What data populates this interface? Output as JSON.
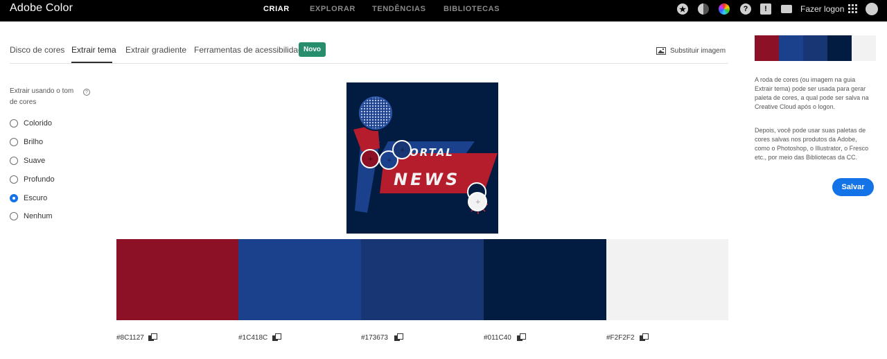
{
  "header": {
    "brand": "Adobe Color",
    "nav": [
      {
        "label": "CRIAR",
        "active": true
      },
      {
        "label": "EXPLORAR",
        "active": false
      },
      {
        "label": "TENDÊNCIAS",
        "active": false
      },
      {
        "label": "BIBLIOTECAS",
        "active": false
      }
    ],
    "icons": [
      "star-icon",
      "contrast-icon",
      "color-wheel-icon",
      "help-icon",
      "alert-icon",
      "chat-icon",
      "apps-grid-icon",
      "creative-cloud-icon"
    ],
    "help_glyph": "?",
    "alert_glyph": "!",
    "login": "Fazer logon"
  },
  "tabs": {
    "items": [
      {
        "label": "Disco de cores",
        "active": false
      },
      {
        "label": "Extrair tema",
        "active": true
      },
      {
        "label": "Extrair gradiente",
        "active": false
      },
      {
        "label": "Ferramentas de acessibilidade",
        "active": false
      }
    ],
    "badge": "Novo",
    "replace_image": "Substituir imagem"
  },
  "options": {
    "label": "Extrair usando o tom de cores",
    "help_glyph": "?",
    "items": [
      {
        "label": "Colorido",
        "checked": false
      },
      {
        "label": "Brilho",
        "checked": false
      },
      {
        "label": "Suave",
        "checked": false
      },
      {
        "label": "Profundo",
        "checked": false
      },
      {
        "label": "Escuro",
        "checked": true
      },
      {
        "label": "Nenhum",
        "checked": false
      }
    ]
  },
  "image": {
    "text_line1": "ORTAL",
    "text_line2": "NEWS",
    "picker_glyph": "+"
  },
  "palette": [
    {
      "hex": "#8C1127",
      "color": "#8c1127"
    },
    {
      "hex": "#1C418C",
      "color": "#1c418c"
    },
    {
      "hex": "#173673",
      "color": "#173673"
    },
    {
      "hex": "#011C40",
      "color": "#011c40"
    },
    {
      "hex": "#F2F2F2",
      "color": "#f2f2f2"
    }
  ],
  "sidebar": {
    "info1": "A roda de cores (ou imagem na guia Extrair tema) pode ser usada para gerar paleta de cores, a qual pode ser salva na Creative Cloud após o logon.",
    "info2": "Depois, você pode usar suas paletas de cores salvas nos produtos da Adobe, como o Photoshop, o Illustrator, o Fresco etc., por meio das Bibliotecas da CC.",
    "save": "Salvar"
  }
}
